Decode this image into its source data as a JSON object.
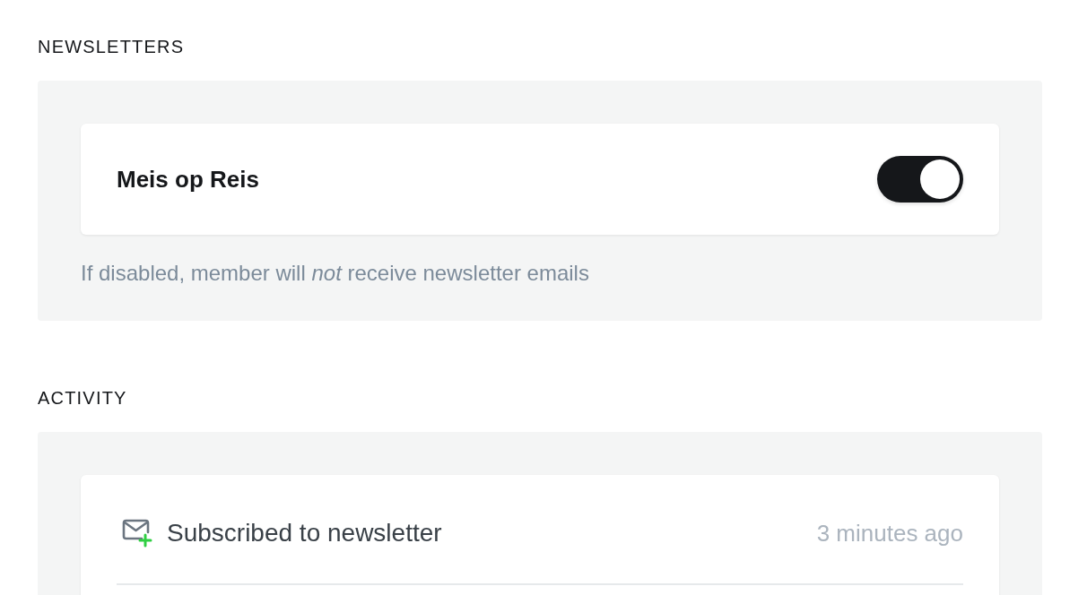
{
  "newsletters": {
    "heading": "NEWSLETTERS",
    "items": [
      {
        "name": "Meis op Reis",
        "on": true
      }
    ],
    "hint": "If disabled, member will *not* receive newsletter emails"
  },
  "activity": {
    "heading": "ACTIVITY",
    "events": [
      {
        "kind": "subscribed",
        "text": "Subscribed to newsletter",
        "time": "3 minutes ago"
      }
    ]
  }
}
